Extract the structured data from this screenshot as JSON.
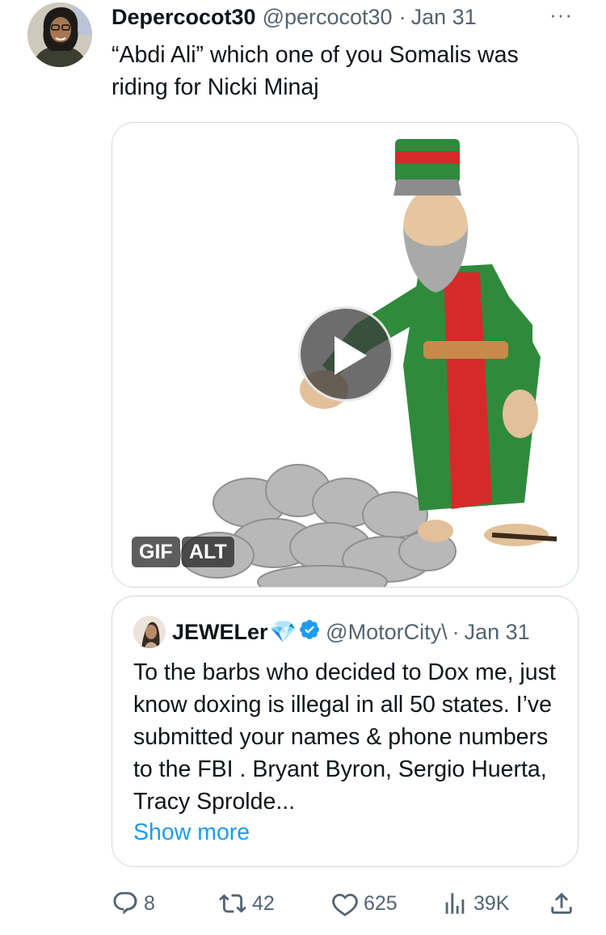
{
  "tweet": {
    "display_name": "Depercocot30",
    "handle": "@percocot30",
    "separator": "·",
    "date": "Jan 31",
    "more_label": "···",
    "text": "“Abdi Ali” which one of you Somalis was riding for Nicki Minaj",
    "media": {
      "gif_badge": "GIF",
      "alt_badge": "ALT",
      "play_icon": "play-icon"
    }
  },
  "quoted_tweet": {
    "display_name": "JEWELer",
    "gem_emoji": "💎",
    "handle": "@MotorCity\\",
    "separator": "·",
    "date": "Jan 31",
    "text": "To the barbs who decided to Dox me, just know doxing is illegal in all 50 states. I’ve submitted your names & phone numbers to the FBI . Bryant Byron, Sergio Huerta, Tracy Sprolde...",
    "show_more": "Show more"
  },
  "actions": {
    "replies": "8",
    "retweets": "42",
    "likes": "625",
    "views": "39K"
  },
  "colors": {
    "text_primary": "#0f1419",
    "text_secondary": "#536471",
    "link": "#1d9bf0",
    "border": "#cfd9de",
    "verified": "#1d9bf0"
  }
}
